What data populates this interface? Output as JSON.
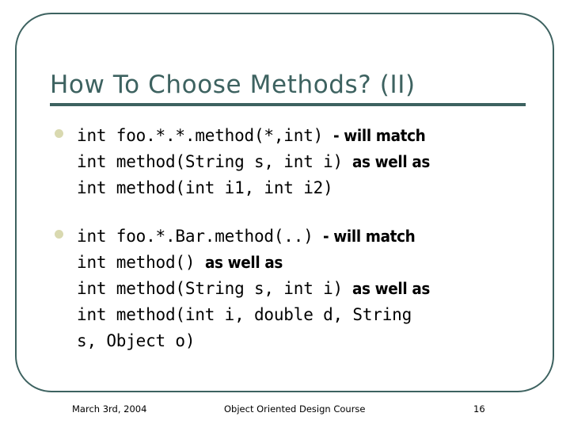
{
  "slide": {
    "title": "How To Choose Methods? (II)",
    "accent_color": "#3d6260",
    "bullet_color": "#d9d9b0",
    "text_color": "#000000",
    "background_color": "#ffffff"
  },
  "bullets": [
    {
      "marker": "bullet-dot",
      "lines": [
        [
          {
            "style": "code",
            "text": "int foo.*.*.method(*,int) "
          },
          {
            "style": "note",
            "text": "- will match"
          }
        ],
        [
          {
            "style": "code",
            "text": "int method(String s, int i) "
          },
          {
            "style": "note",
            "text": "as well as"
          }
        ],
        [
          {
            "style": "code",
            "text": "int method(int i1, int i2)"
          }
        ]
      ]
    },
    {
      "marker": "bullet-dot",
      "lines": [
        [
          {
            "style": "code",
            "text": "int foo.*.Bar.method(..) "
          },
          {
            "style": "note",
            "text": "- will match"
          }
        ],
        [
          {
            "style": "code",
            "text": "int method() "
          },
          {
            "style": "note",
            "text": "as well as"
          }
        ],
        [
          {
            "style": "code",
            "text": "int method(String s, int i) "
          },
          {
            "style": "note",
            "text": "as well as"
          }
        ],
        [
          {
            "style": "code",
            "text": "int method(int i, double d, String"
          }
        ],
        [
          {
            "style": "code",
            "text": "s, Object o)"
          }
        ]
      ]
    }
  ],
  "footer": {
    "date": "March 3rd, 2004",
    "course": "Object Oriented Design Course",
    "page_number": "16"
  }
}
